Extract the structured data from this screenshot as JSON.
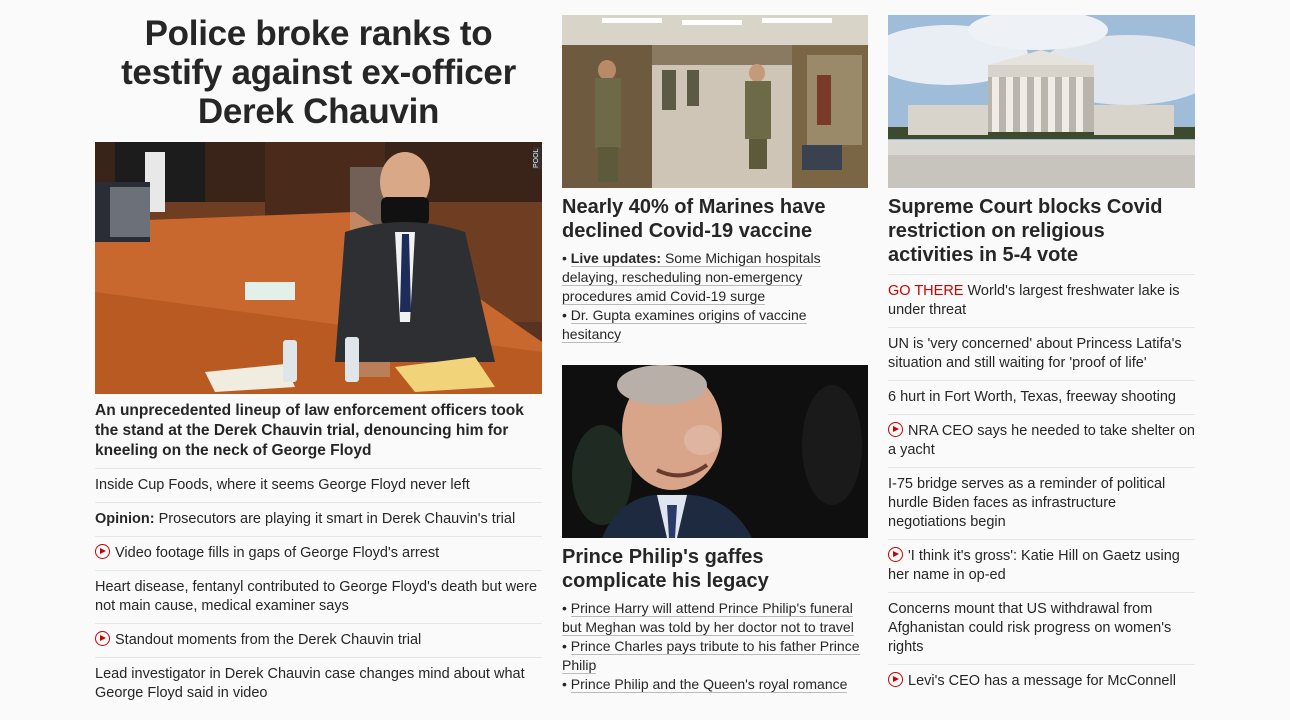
{
  "lead": {
    "headline": "Police broke ranks to testify against ex-officer Derek Chauvin",
    "image_label": "POOL",
    "subhead": "An unprecedented lineup of law enforcement officers took the stand at the Derek Chauvin trial, denouncing him for kneeling on the neck of George Floyd",
    "stories": [
      {
        "text": "Inside Cup Foods, where it seems George Floyd never left"
      },
      {
        "prefix": "Opinion:",
        "text": " Prosecutors are playing it smart in Derek Chauvin's trial"
      },
      {
        "video": true,
        "text": "Video footage fills in gaps of George Floyd's arrest"
      },
      {
        "text": "Heart disease, fentanyl contributed to George Floyd's death but were not main cause, medical examiner says"
      },
      {
        "video": true,
        "text": "Standout moments from the Derek Chauvin trial"
      },
      {
        "text": "Lead investigator in Derek Chauvin case changes mind about what George Floyd said in video"
      }
    ]
  },
  "marines": {
    "title": "Nearly 40% of Marines have declined Covid-19 vaccine",
    "bullets": [
      {
        "prefix": "Live updates:",
        "text": "Some Michigan hospitals delaying, rescheduling non-emergency procedures amid Covid-19 surge"
      },
      {
        "text": "Dr. Gupta examines origins of vaccine hesitancy"
      }
    ]
  },
  "philip": {
    "title": "Prince Philip's gaffes complicate his legacy",
    "bullets": [
      {
        "text": "Prince Harry will attend Prince Philip's funeral but Meghan was told by her doctor not to travel"
      },
      {
        "text": "Prince Charles pays tribute to his father Prince Philip"
      },
      {
        "text": "Prince Philip and the Queen's royal romance"
      }
    ]
  },
  "scotus": {
    "title": "Supreme Court blocks Covid restriction on religious activities in 5-4 vote",
    "stories": [
      {
        "kicker": "GO THERE",
        "text": " World's largest freshwater lake is under threat"
      },
      {
        "text": "UN is 'very concerned' about Princess Latifa's situation and still waiting for 'proof of life'"
      },
      {
        "text": "6 hurt in Fort Worth, Texas, freeway shooting"
      },
      {
        "video": true,
        "text": "NRA CEO says he needed to take shelter on a yacht"
      },
      {
        "text": "I-75 bridge serves as a reminder of political hurdle Biden faces as infrastructure negotiations begin"
      },
      {
        "video": true,
        "text": "'I think it's gross': Katie Hill on Gaetz using her name in op-ed"
      },
      {
        "text": "Concerns mount that US withdrawal from Afghanistan could risk progress on women's rights"
      },
      {
        "video": true,
        "text": "Levi's CEO has a message for McConnell"
      }
    ]
  },
  "colors": {
    "accent_red": "#cc0000",
    "text": "#262626",
    "divider": "#e6e6e6"
  }
}
